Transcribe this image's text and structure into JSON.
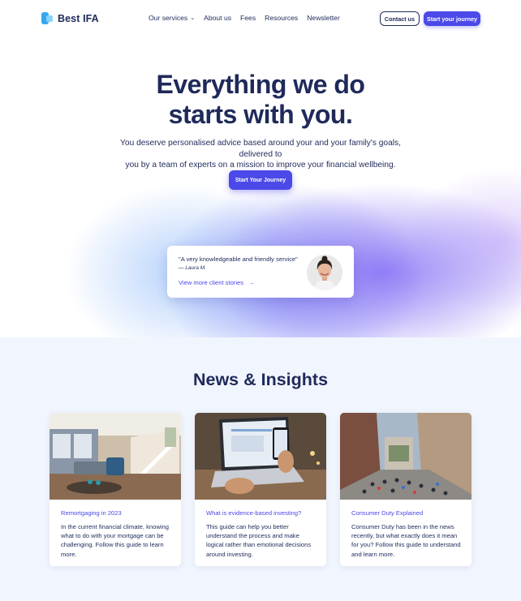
{
  "nav": {
    "brand": "Best IFA",
    "links": [
      "Our services",
      "About us",
      "Fees",
      "Resources",
      "Newsletter"
    ],
    "contact_label": "Contact us",
    "journey_label": "Start your journey"
  },
  "hero": {
    "title_line1": "Everything we do",
    "title_line2": "starts with you.",
    "subtitle_line1": "You deserve personalised advice based around your and your family's goals, delivered to",
    "subtitle_line2": "you by a team of experts on a mission to improve your financial wellbeing.",
    "cta_label": "Start Your Journey"
  },
  "testimonial": {
    "quote": "\"A very knowledgeable and friendly service\"",
    "author": "— Laura M.",
    "link_label": "View more client stories",
    "link_arrow": "→"
  },
  "news": {
    "title": "News & Insights",
    "cards": [
      {
        "title": "Remortgaging in 2023",
        "body": "In the current financial climate, knowing what to do with your mortgage can be challenging. Follow this guide to learn more."
      },
      {
        "title": "What is evidence-based investing?",
        "body": "This guide can help you better understand the process and make logical rather than emotional decisions around investing."
      },
      {
        "title": "Consumer Duty Explained",
        "body": "Consumer Duty has been in the news recently, but what exactly does it mean for you? Follow this guide to understand and learn more."
      }
    ]
  },
  "colors": {
    "accent": "#4b49e8",
    "navy": "#1f2a5a",
    "news_bg": "#f1f5fd"
  },
  "icons": [
    "logo-mark-icon",
    "chevron-down-icon",
    "arrow-right-icon"
  ]
}
